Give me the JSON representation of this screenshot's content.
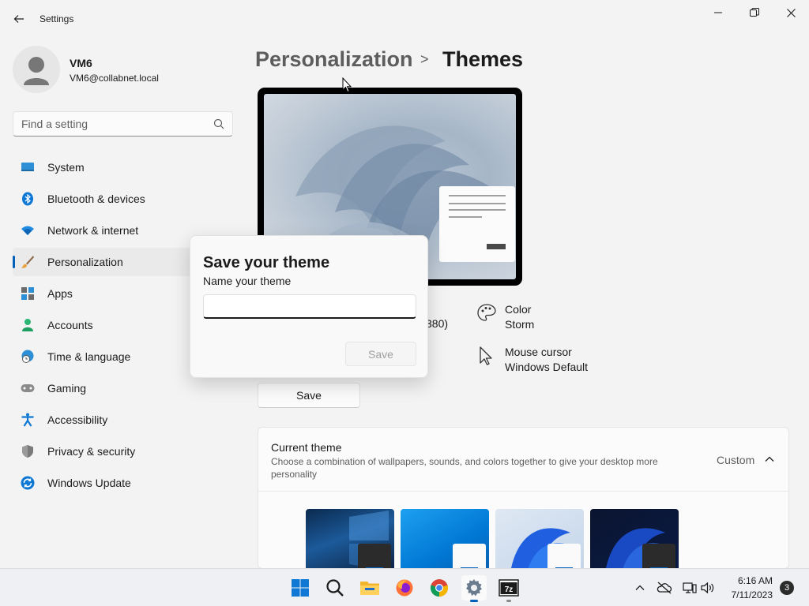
{
  "window": {
    "title": "Settings",
    "controls": {
      "minimize": "minimize-icon",
      "maximize": "maximize-icon",
      "close": "close-icon"
    }
  },
  "user": {
    "name": "VM6",
    "email": "VM6@collabnet.local"
  },
  "search": {
    "placeholder": "Find a setting",
    "value": ""
  },
  "sidebar": {
    "items": [
      {
        "label": "System",
        "icon": "system-icon",
        "active": false
      },
      {
        "label": "Bluetooth & devices",
        "icon": "bluetooth-icon",
        "active": false
      },
      {
        "label": "Network & internet",
        "icon": "wifi-icon",
        "active": false
      },
      {
        "label": "Personalization",
        "icon": "brush-icon",
        "active": true
      },
      {
        "label": "Apps",
        "icon": "apps-icon",
        "active": false
      },
      {
        "label": "Accounts",
        "icon": "accounts-icon",
        "active": false
      },
      {
        "label": "Time & language",
        "icon": "globe-clock-icon",
        "active": false
      },
      {
        "label": "Gaming",
        "icon": "gamepad-icon",
        "active": false
      },
      {
        "label": "Accessibility",
        "icon": "accessibility-icon",
        "active": false
      },
      {
        "label": "Privacy & security",
        "icon": "shield-icon",
        "active": false
      },
      {
        "label": "Windows Update",
        "icon": "update-icon",
        "active": false
      }
    ]
  },
  "breadcrumb": {
    "parent": "Personalization",
    "separator": ">",
    "current": "Themes"
  },
  "theme_info": {
    "partial_text": "380)",
    "color": {
      "title": "Color",
      "value": "Storm"
    },
    "cursor": {
      "title": "Mouse cursor",
      "value": "Windows Default"
    },
    "save_label": "Save"
  },
  "current_theme": {
    "title": "Current theme",
    "description": "Choose a combination of wallpapers, sounds, and colors together to give your desktop more personality",
    "value": "Custom"
  },
  "dialog": {
    "title": "Save your theme",
    "subtitle": "Name your theme",
    "input_value": "",
    "save_label": "Save"
  },
  "taskbar": {
    "apps": [
      "start-icon",
      "search-icon",
      "file-explorer-icon",
      "firefox-icon",
      "chrome-icon",
      "settings-icon",
      "7zip-icon"
    ],
    "time": "6:16 AM",
    "date": "7/11/2023",
    "notifications": "3"
  },
  "colors": {
    "accent": "#005fb8",
    "background": "#f3f3f3",
    "card": "#fbfbfb"
  }
}
